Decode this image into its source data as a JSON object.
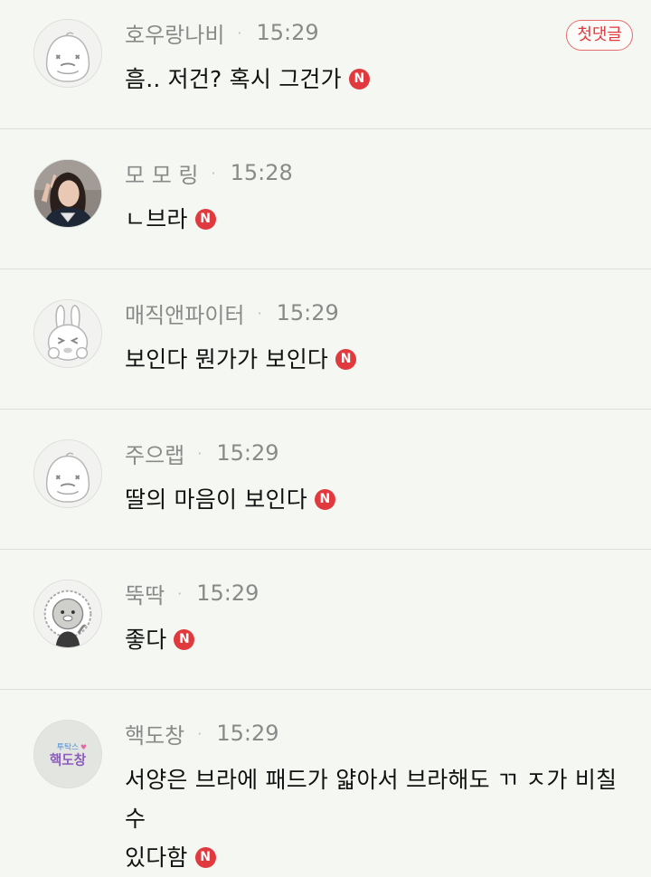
{
  "comments": [
    {
      "author": "호우랑나비",
      "separator": "·",
      "time": "15:29",
      "text": "흠.. 저건? 혹시 그건가",
      "new_badge": "N",
      "first_badge": "첫댓글",
      "avatar": "apeach-icon"
    },
    {
      "author": "모 모 링",
      "separator": "·",
      "time": "15:28",
      "text": "ㄴ브라",
      "new_badge": "N",
      "avatar": "profile-photo"
    },
    {
      "author": "매직앤파이터",
      "separator": "·",
      "time": "15:29",
      "text": "보인다 뭔가가 보인다",
      "new_badge": "N",
      "avatar": "muzi-icon"
    },
    {
      "author": "주으랩",
      "separator": "·",
      "time": "15:29",
      "text": "딸의 마음이 보인다",
      "new_badge": "N",
      "avatar": "apeach-icon"
    },
    {
      "author": "뚝딱",
      "separator": "·",
      "time": "15:29",
      "text": "좋다",
      "new_badge": "N",
      "avatar": "ryan-icon"
    },
    {
      "author": "핵도창",
      "separator": "·",
      "time": "15:29",
      "text_line1": "서양은 브라에 패드가 얇아서 브라해도 ㄲ ㅈ가 비칠수",
      "text_line2": "있다함",
      "new_badge": "N",
      "avatar_text": "투탁스♥ 핵도창"
    }
  ],
  "colors": {
    "background": "#f5f8f2",
    "badge_red": "#e0393e",
    "meta_gray": "#8a8a8a",
    "divider": "#dcdfd8"
  }
}
